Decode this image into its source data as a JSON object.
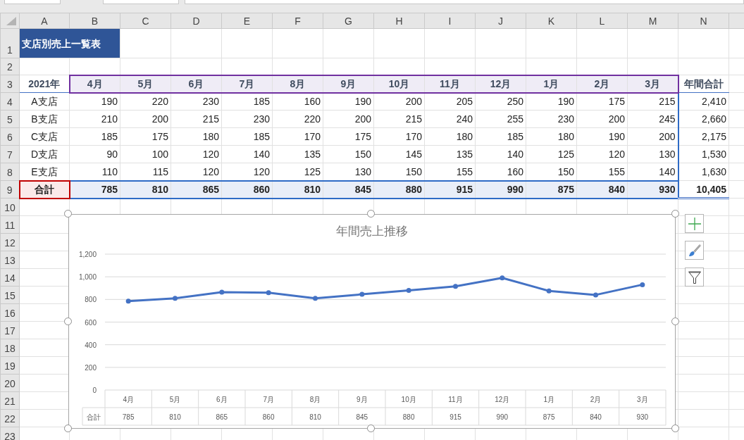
{
  "column_headers": [
    "A",
    "B",
    "C",
    "D",
    "E",
    "F",
    "G",
    "H",
    "I",
    "J",
    "K",
    "L",
    "M",
    "N"
  ],
  "row_numbers": [
    "1",
    "2",
    "3",
    "4",
    "5",
    "6",
    "7",
    "8",
    "9",
    "10",
    "11",
    "12",
    "13",
    "14",
    "15",
    "16",
    "17",
    "18",
    "19",
    "20",
    "21",
    "22",
    "23"
  ],
  "sheet": {
    "title": "支店別売上一覧表",
    "year_label": "2021年",
    "months": [
      "4月",
      "5月",
      "6月",
      "7月",
      "8月",
      "9月",
      "10月",
      "11月",
      "12月",
      "1月",
      "2月",
      "3月"
    ],
    "total_header": "年間合計",
    "rows": [
      {
        "branch": "A支店",
        "values": [
          "190",
          "220",
          "230",
          "185",
          "160",
          "190",
          "200",
          "205",
          "250",
          "190",
          "175",
          "215"
        ],
        "total": "2,410"
      },
      {
        "branch": "B支店",
        "values": [
          "210",
          "200",
          "215",
          "230",
          "220",
          "200",
          "215",
          "240",
          "255",
          "230",
          "200",
          "245"
        ],
        "total": "2,660"
      },
      {
        "branch": "C支店",
        "values": [
          "185",
          "175",
          "180",
          "185",
          "170",
          "175",
          "170",
          "180",
          "185",
          "180",
          "190",
          "200"
        ],
        "total": "2,175"
      },
      {
        "branch": "D支店",
        "values": [
          "90",
          "100",
          "120",
          "140",
          "135",
          "150",
          "145",
          "135",
          "140",
          "125",
          "120",
          "130"
        ],
        "total": "1,530"
      },
      {
        "branch": "E支店",
        "values": [
          "110",
          "115",
          "120",
          "120",
          "125",
          "130",
          "150",
          "155",
          "160",
          "150",
          "155",
          "140"
        ],
        "total": "1,630"
      }
    ],
    "total_row": {
      "label": "合計",
      "values": [
        "785",
        "810",
        "865",
        "860",
        "810",
        "845",
        "880",
        "915",
        "990",
        "875",
        "840",
        "930"
      ],
      "total": "10,405"
    }
  },
  "chart": {
    "chart_data": {
      "type": "line",
      "title": "年間売上推移",
      "categories": [
        "4月",
        "5月",
        "6月",
        "7月",
        "8月",
        "9月",
        "10月",
        "11月",
        "12月",
        "1月",
        "2月",
        "3月"
      ],
      "series": [
        {
          "name": "合計",
          "color": "#4472c4",
          "marker": true,
          "values": [
            785,
            810,
            865,
            860,
            810,
            845,
            880,
            915,
            990,
            875,
            840,
            930
          ]
        }
      ],
      "grid": true,
      "ylim": [
        0,
        1200
      ],
      "yticks": [
        0,
        200,
        400,
        600,
        800,
        {
          "value": 1000,
          "label": "1,000"
        },
        {
          "value": 1200,
          "label": "1,200"
        }
      ]
    },
    "data_table": {
      "values": [
        "785",
        "810",
        "865",
        "860",
        "810",
        "845",
        "880",
        "915",
        "990",
        "875",
        "840",
        "930"
      ]
    }
  }
}
